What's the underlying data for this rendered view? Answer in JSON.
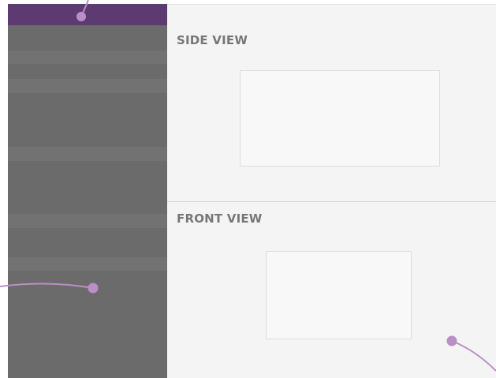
{
  "sidebar": {
    "background": "#6b6b6b",
    "header_color": "#5e3a72",
    "row_color": "#727272",
    "row_count": 8
  },
  "main": {
    "panels": [
      {
        "title": "SIDE VIEW"
      },
      {
        "title": "FRONT VIEW"
      }
    ],
    "background": "#f4f4f4"
  },
  "callouts": {
    "color": "#b98fc6",
    "count": 3
  }
}
